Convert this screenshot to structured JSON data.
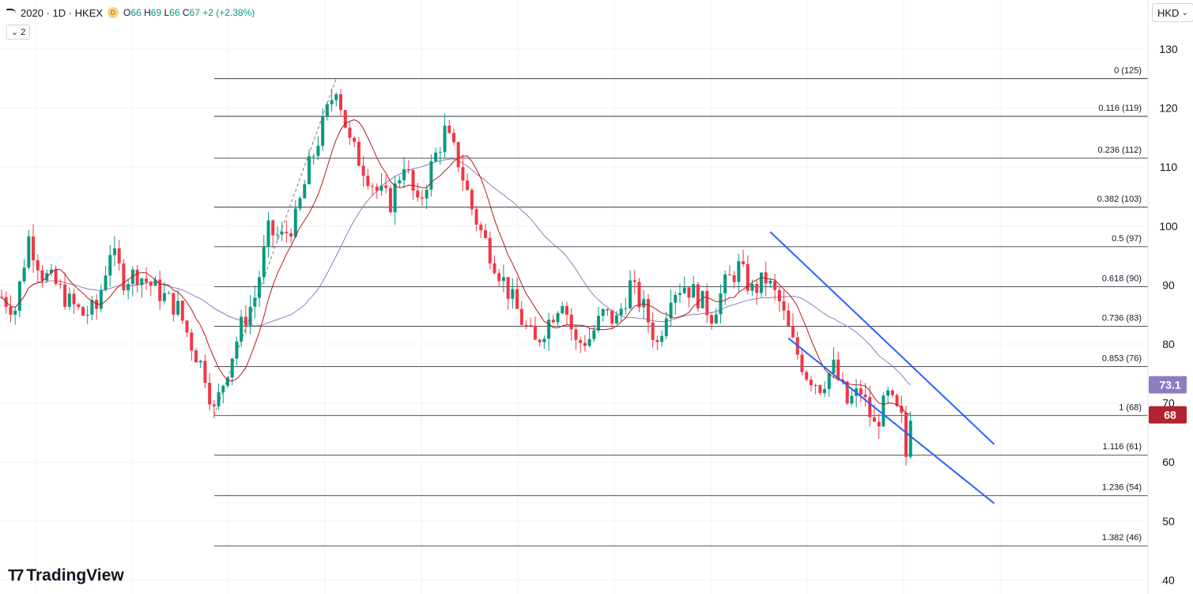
{
  "header": {
    "symbol": "2020 · 1D · HKEX",
    "badge": "D",
    "ohlc": {
      "o_label": "O",
      "o": "66",
      "h_label": "H",
      "h": "69",
      "l_label": "L",
      "l": "66",
      "c_label": "C",
      "c": "67",
      "change": "+2 (+2.38%)"
    }
  },
  "indicator_toggle": {
    "label": "2"
  },
  "currency": {
    "label": "HKD"
  },
  "brand": {
    "name": "TradingView"
  },
  "colors": {
    "up": "#089981",
    "down": "#f23645",
    "ma_fast": "#b71c1c",
    "ma_slow": "#8e7cc3",
    "channel": "#2962ff",
    "fib": "#131722",
    "ma_slow_badge": "#8e7cc3",
    "price_badge": "#b2232f"
  },
  "chart_data": {
    "type": "candlestick",
    "yaxis": {
      "min": 40,
      "max": 130,
      "ticks": [
        130,
        120,
        110,
        100,
        90,
        80,
        70,
        60,
        50,
        40
      ],
      "hidden_ticks": [
        70
      ]
    },
    "price_labels": [
      {
        "value": 73.1,
        "text": "73.1",
        "kind": "ma_slow"
      },
      {
        "value": 68,
        "text": "68",
        "kind": "last_price"
      }
    ],
    "fib_levels": [
      {
        "ratio": "0",
        "price": 125,
        "label": "0 (125)"
      },
      {
        "ratio": "0.116",
        "price": 118.6,
        "label": "0.116 (119)"
      },
      {
        "ratio": "0.236",
        "price": 111.5,
        "label": "0.236 (112)"
      },
      {
        "ratio": "0.382",
        "price": 103.2,
        "label": "0.382 (103)"
      },
      {
        "ratio": "0.5",
        "price": 96.5,
        "label": "0.5 (97)"
      },
      {
        "ratio": "0.618",
        "price": 89.7,
        "label": "0.618 (90)"
      },
      {
        "ratio": "0.736",
        "price": 83.0,
        "label": "0.736 (83)"
      },
      {
        "ratio": "0.853",
        "price": 76.2,
        "label": "0.853 (76)"
      },
      {
        "ratio": "1",
        "price": 67.9,
        "label": "1 (68)"
      },
      {
        "ratio": "1.116",
        "price": 61.2,
        "label": "1.116 (61)"
      },
      {
        "ratio": "1.236",
        "price": 54.3,
        "label": "1.236 (54)"
      },
      {
        "ratio": "1.382",
        "price": 45.8,
        "label": "1.382 (46)"
      }
    ],
    "fib_anchor": {
      "from_bar": 47,
      "from_price": 67.9,
      "to_bar": 74,
      "to_price": 125
    },
    "channel_lines": [
      {
        "from_bar": 163,
        "from_price": 99,
        "to_bar": 209,
        "to_price": 63
      },
      {
        "from_bar": 167,
        "from_price": 81,
        "to_bar": 209,
        "to_price": 53
      }
    ],
    "price_path": [
      [
        0,
        88
      ],
      [
        3,
        86
      ],
      [
        6,
        98
      ],
      [
        9,
        92
      ],
      [
        12,
        90
      ],
      [
        15,
        87
      ],
      [
        18,
        85
      ],
      [
        21,
        86
      ],
      [
        24,
        96
      ],
      [
        27,
        91
      ],
      [
        30,
        92
      ],
      [
        33,
        90
      ],
      [
        36,
        88
      ],
      [
        39,
        86
      ],
      [
        42,
        80
      ],
      [
        45,
        75
      ],
      [
        47,
        68.5
      ],
      [
        50,
        76
      ],
      [
        53,
        83
      ],
      [
        56,
        88
      ],
      [
        59,
        99
      ],
      [
        62,
        98
      ],
      [
        65,
        101
      ],
      [
        68,
        110
      ],
      [
        71,
        117
      ],
      [
        74,
        124
      ],
      [
        77,
        114
      ],
      [
        80,
        110
      ],
      [
        83,
        106
      ],
      [
        86,
        104
      ],
      [
        89,
        111
      ],
      [
        92,
        103
      ],
      [
        95,
        110
      ],
      [
        98,
        116
      ],
      [
        101,
        111
      ],
      [
        104,
        103
      ],
      [
        106,
        99
      ],
      [
        109,
        94
      ],
      [
        112,
        89
      ],
      [
        115,
        84
      ],
      [
        118,
        80
      ],
      [
        121,
        84
      ],
      [
        124,
        88
      ],
      [
        127,
        80
      ],
      [
        130,
        81
      ],
      [
        133,
        85
      ],
      [
        136,
        84
      ],
      [
        139,
        90
      ],
      [
        142,
        86
      ],
      [
        145,
        80
      ],
      [
        148,
        89
      ],
      [
        151,
        90
      ],
      [
        154,
        88
      ],
      [
        157,
        85
      ],
      [
        160,
        90
      ],
      [
        163,
        93
      ],
      [
        166,
        89
      ],
      [
        169,
        91
      ],
      [
        172,
        87
      ],
      [
        175,
        80
      ],
      [
        178,
        75
      ],
      [
        181,
        73
      ],
      [
        184,
        76
      ],
      [
        187,
        70
      ],
      [
        190,
        72
      ],
      [
        193,
        66
      ],
      [
        196,
        71
      ],
      [
        199,
        67
      ],
      [
        200,
        61
      ],
      [
        201,
        67
      ]
    ],
    "x_range": {
      "first_bar": 0,
      "last_bar": 210
    }
  }
}
